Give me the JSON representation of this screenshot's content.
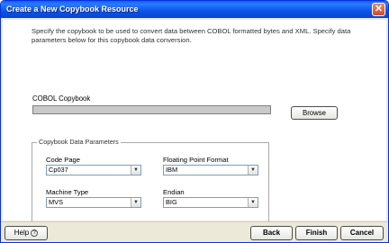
{
  "window": {
    "title": "Create a New Copybook Resource",
    "close_glyph": "✕"
  },
  "description": "Specify the copybook to be used to convert data between COBOL formatted bytes and XML.  Specify data parameters below for this copybook data conversion.",
  "cobol_copybook": {
    "label": "COBOL Copybook",
    "value": "",
    "browse_label": "Browse"
  },
  "params": {
    "legend": "Copybook Data Parameters",
    "code_page": {
      "label": "Code Page",
      "value": "Cp037"
    },
    "floating_point": {
      "label": "Floating Point Format",
      "value": "IBM"
    },
    "machine_type": {
      "label": "Machine Type",
      "value": "MVS"
    },
    "endian": {
      "label": "Endian",
      "value": "BIG"
    }
  },
  "footer": {
    "help_label": "Help",
    "help_icon_glyph": "?",
    "back_label": "Back",
    "finish_label": "Finish",
    "cancel_label": "Cancel"
  }
}
